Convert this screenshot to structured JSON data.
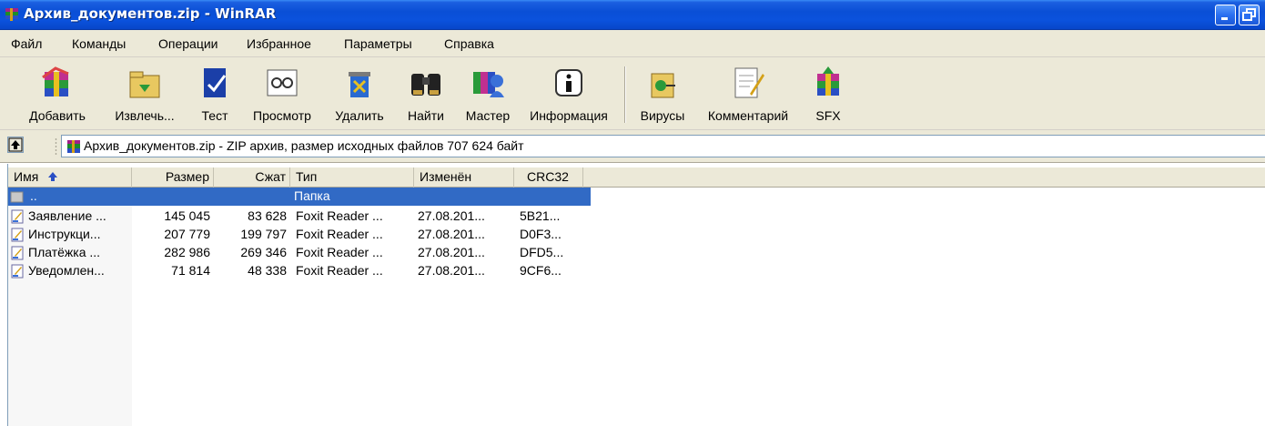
{
  "window": {
    "title": "Архив_документов.zip - WinRAR"
  },
  "menu": [
    "Файл",
    "Команды",
    "Операции",
    "Избранное",
    "Параметры",
    "Справка"
  ],
  "toolbar": {
    "add": "Добавить",
    "extract": "Извлечь...",
    "test": "Тест",
    "view": "Просмотр",
    "delete": "Удалить",
    "find": "Найти",
    "wizard": "Мастер",
    "info": "Информация",
    "virus": "Вирусы",
    "comment": "Комментарий",
    "sfx": "SFX"
  },
  "address": {
    "text": "Архив_документов.zip - ZIP архив, размер исходных файлов 707 624 байт"
  },
  "columns": {
    "name": "Имя",
    "size": "Размер",
    "packed": "Сжат",
    "type": "Тип",
    "modified": "Изменён",
    "crc": "CRC32"
  },
  "rows": [
    {
      "name": "..",
      "size": "",
      "packed": "",
      "type": "Папка",
      "modified": "",
      "crc": ""
    },
    {
      "name": "Заявление ...",
      "size": "145 045",
      "packed": "83 628",
      "type": "Foxit Reader ...",
      "modified": "27.08.201...",
      "crc": "5B21..."
    },
    {
      "name": "Инструкци...",
      "size": "207 779",
      "packed": "199 797",
      "type": "Foxit Reader ...",
      "modified": "27.08.201...",
      "crc": "D0F3..."
    },
    {
      "name": "Платёжка ...",
      "size": "282 986",
      "packed": "269 346",
      "type": "Foxit Reader ...",
      "modified": "27.08.201...",
      "crc": "DFD5..."
    },
    {
      "name": "Уведомлен...",
      "size": "71 814",
      "packed": "48 338",
      "type": "Foxit Reader ...",
      "modified": "27.08.201...",
      "crc": "9CF6..."
    }
  ]
}
